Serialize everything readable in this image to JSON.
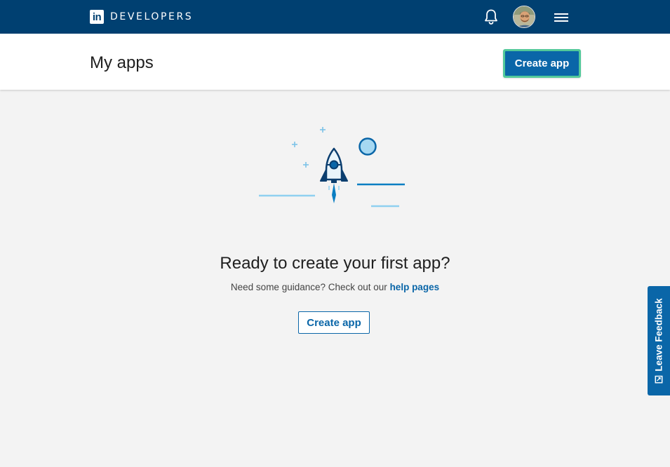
{
  "nav": {
    "logo": "in",
    "brand": "DEVELOPERS",
    "icons": {
      "notifications": "bell-icon",
      "menu": "hamburger-menu-icon"
    }
  },
  "header": {
    "title": "My apps",
    "create_button": "Create app"
  },
  "empty_state": {
    "title": "Ready to create your first app?",
    "subtitle": "Need some guidance? Check out our",
    "help_link": "help pages",
    "create_button": "Create app",
    "illustration": "rocket-illustration"
  },
  "feedback": {
    "label": "Leave Feedback"
  },
  "colors": {
    "nav_bg": "#004071",
    "primary": "#0a66a8",
    "highlight": "#52c99a",
    "page_bg": "#f3f3f3"
  }
}
